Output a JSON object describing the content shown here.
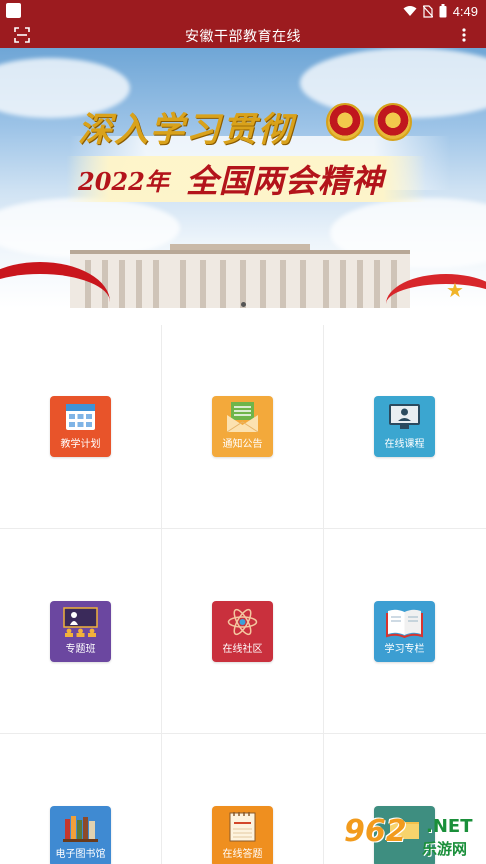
{
  "status_bar": {
    "time": "4:49"
  },
  "app_bar": {
    "title": "安徽干部教育在线"
  },
  "banner": {
    "line1": "深入学习贯彻",
    "line2_year": "2022年",
    "line2_main": "全国两会精神"
  },
  "grid": {
    "items": [
      {
        "label": "教学计划",
        "icon": "calendar-icon",
        "color": "#e8542a"
      },
      {
        "label": "通知公告",
        "icon": "envelope-icon",
        "color": "#f3a93b"
      },
      {
        "label": "在线课程",
        "icon": "monitor-icon",
        "color": "#3ba6d0"
      },
      {
        "label": "专题班",
        "icon": "classroom-icon",
        "color": "#6b47a0"
      },
      {
        "label": "在线社区",
        "icon": "atom-icon",
        "color": "#c9303d"
      },
      {
        "label": "学习专栏",
        "icon": "book-icon",
        "color": "#3c9ed2"
      },
      {
        "label": "电子图书馆",
        "icon": "bookshelf-icon",
        "color": "#3f8ad2"
      },
      {
        "label": "在线答题",
        "icon": "notepad-icon",
        "color": "#ef8f1f"
      },
      {
        "label": "",
        "icon": "folder-icon",
        "color": "#3e8e80"
      }
    ]
  },
  "watermark": {
    "number": "962",
    "net": ".NET",
    "cn": "乐游网"
  }
}
